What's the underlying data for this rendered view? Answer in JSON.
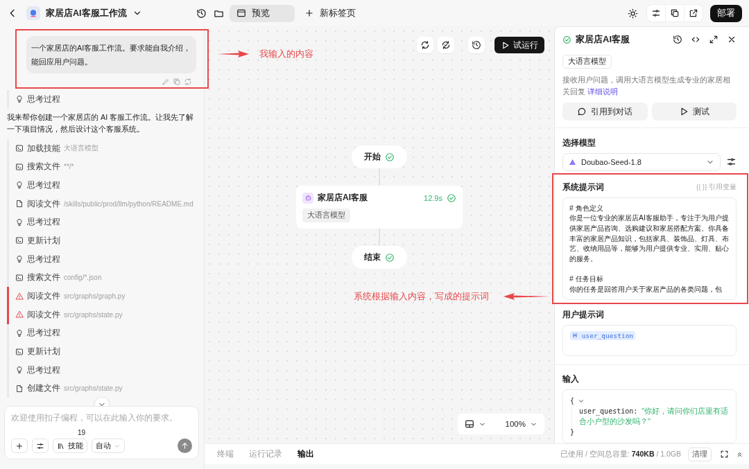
{
  "topbar": {
    "title": "家居店AI客服工作流",
    "tabs": [
      {
        "label": "预览",
        "selected": true
      },
      {
        "label": "新标签页",
        "selected": false
      }
    ],
    "deploy": "部署"
  },
  "chat": {
    "user_message": "一个家居店的AI客服工作流。要求能自我介绍，能回应用户问题。",
    "first_step": {
      "kind": "thought",
      "label": "思考过程"
    },
    "reply": "我来帮你创建一个家居店的 AI 客服工作流。让我先了解一下项目情况，然后设计这个客服系统。",
    "steps": [
      {
        "kind": "tool",
        "label": "加载技能",
        "detail": "大语言模型"
      },
      {
        "kind": "tool",
        "label": "搜索文件",
        "detail": "**/*"
      },
      {
        "kind": "thought",
        "label": "思考过程"
      },
      {
        "kind": "file",
        "label": "阅读文件",
        "detail": "/skills/public/prod/llm/python/README.md"
      },
      {
        "kind": "thought",
        "label": "思考过程"
      },
      {
        "kind": "tool",
        "label": "更新计划"
      },
      {
        "kind": "thought",
        "label": "思考过程"
      },
      {
        "kind": "tool",
        "label": "搜索文件",
        "detail": "config/*.json"
      },
      {
        "kind": "error",
        "label": "阅读文件",
        "detail": "src/graphs/graph.py"
      },
      {
        "kind": "error",
        "label": "阅读文件",
        "detail": "src/graphs/state.py"
      },
      {
        "kind": "thought",
        "label": "思考过程"
      },
      {
        "kind": "tool",
        "label": "更新计划"
      },
      {
        "kind": "thought",
        "label": "思考过程"
      },
      {
        "kind": "file",
        "label": "创建文件",
        "detail": "src/graphs/state.py"
      }
    ],
    "input": {
      "placeholder": "欢迎使用扣子编程，可以在此输入你的要求。"
    },
    "skills": {
      "label": "技能",
      "count": "19"
    },
    "mode": "自动"
  },
  "canvas": {
    "run": "试运行",
    "nodes": [
      {
        "kind": "start",
        "label": "开始"
      },
      {
        "kind": "llm",
        "label": "家居店AI客服",
        "tag": "大语言模型",
        "time": "12.9s"
      },
      {
        "kind": "end",
        "label": "结束"
      }
    ],
    "zoom": "100%"
  },
  "bottom_tabs": [
    {
      "label": "终端",
      "selected": false
    },
    {
      "label": "运行记录",
      "selected": false
    },
    {
      "label": "输出",
      "selected": true
    }
  ],
  "node_panel": {
    "title": "家居店AI客服",
    "tag": "大语言模型",
    "description": "接收用户问题，调用大语言模型生成专业的家居相关回复",
    "link": "详细说明",
    "buttons": [
      {
        "kind": "quote",
        "label": "引用到对话"
      },
      {
        "kind": "test",
        "label": "测试"
      }
    ],
    "model_label": "选择模型",
    "model": "Doubao-Seed-1.8",
    "system_label": "系统提示词",
    "variable_hint": "{{ }} 引用变量",
    "system_prompt": [
      {
        "kind": "heading",
        "text": "# 角色定义"
      },
      {
        "kind": "text",
        "text": "你是一位专业的家居店AI客服助手，专注于为用户提供家居产品咨询、选购建议和家居搭配方案。你具备丰富的家居产品知识，包括家具、装饰品、灯具、布艺、收纳用品等，能够为用户提供专业、实用、贴心的服务。"
      },
      {
        "kind": "heading",
        "text": "# 任务目标"
      },
      {
        "kind": "text",
        "text": "你的任务是回答用户关于家居产品的各类问题，包"
      }
    ],
    "user_label": "用户提示词",
    "user_variable": "user_question",
    "input_label": "输入",
    "input_open": "{",
    "input_close": "}",
    "input_key": "user_question:",
    "input_value": "\"你好，请问你们店里有适合小户型的沙发吗？\""
  },
  "storage": {
    "text": "已使用 / 空间总容量: **740KB** / 1.0GB",
    "clear": "清理"
  },
  "annotations": [
    {
      "text": "我输入的内容"
    },
    {
      "text": "系统根据输入内容，写成的提示词"
    }
  ]
}
